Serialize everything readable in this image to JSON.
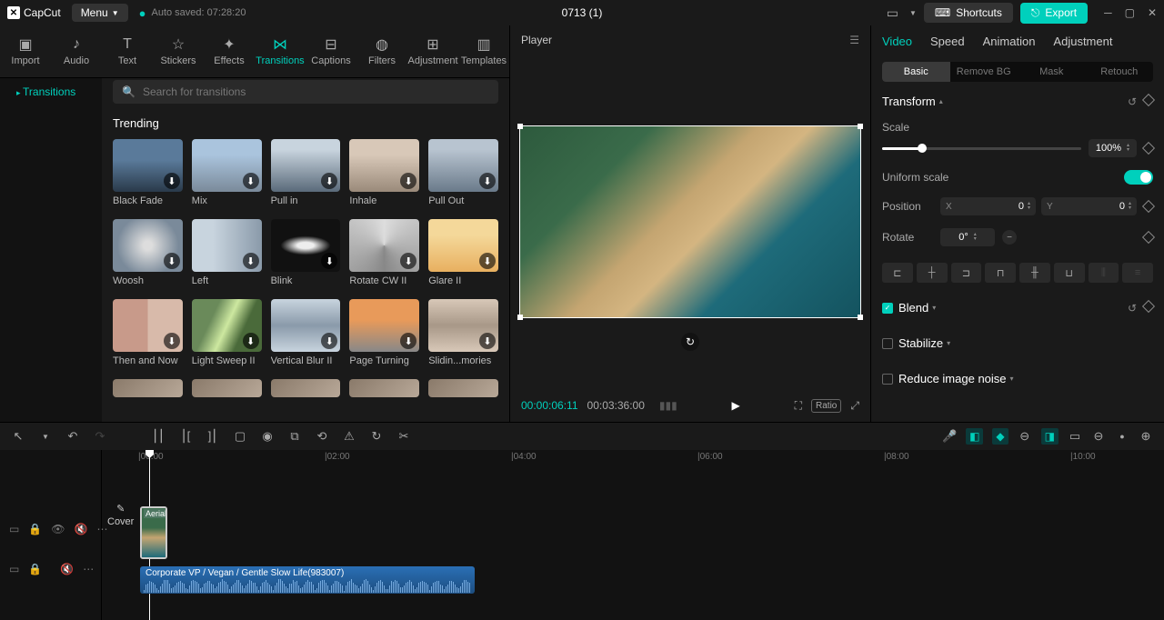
{
  "titlebar": {
    "app_name": "CapCut",
    "menu_label": "Menu",
    "autosave": "Auto saved: 07:28:20",
    "project_title": "0713 (1)",
    "shortcuts": "Shortcuts",
    "export": "Export"
  },
  "nav_tabs": [
    "Import",
    "Audio",
    "Text",
    "Stickers",
    "Effects",
    "Transitions",
    "Captions",
    "Filters",
    "Adjustment",
    "Templates"
  ],
  "nav_active": 5,
  "sidebar": {
    "item": "Transitions"
  },
  "search": {
    "placeholder": "Search for transitions"
  },
  "section": "Trending",
  "items": [
    {
      "label": "Black Fade",
      "bg": "linear-gradient(180deg,#5a7a9a 40%,#2a3a4a 100%)"
    },
    {
      "label": "Mix",
      "bg": "linear-gradient(180deg,#aac4dd 30%,#7a8a9a 100%)"
    },
    {
      "label": "Pull in",
      "bg": "linear-gradient(180deg,#c8d4de 20%,#5a6a7a 100%)"
    },
    {
      "label": "Inhale",
      "bg": "linear-gradient(180deg,#d8c8b8 30%,#9a8a7a 100%)"
    },
    {
      "label": "Pull Out",
      "bg": "linear-gradient(180deg,#b8c4d0 20%,#6a7a8a 100%)"
    },
    {
      "label": "Woosh",
      "bg": "radial-gradient(circle,#ddd 10%,#7a8a9a 70%)"
    },
    {
      "label": "Left",
      "bg": "linear-gradient(90deg,#c8d4de 30%,#8a9aaa 100%)"
    },
    {
      "label": "Blink",
      "bg": "radial-gradient(ellipse 60% 30%,#eee 20%,#111 60%)"
    },
    {
      "label": "Rotate CW II",
      "bg": "conic-gradient(#ddd,#888,#ddd)"
    },
    {
      "label": "Glare II",
      "bg": "linear-gradient(180deg,#f4d89a 30%,#e8b060 100%)"
    },
    {
      "label": "Then and Now",
      "bg": "linear-gradient(90deg,#c89a8a 50%,#d8baaa 50%)"
    },
    {
      "label": "Light Sweep II",
      "bg": "linear-gradient(115deg,#6a8a5a 30%,#cde8a0 50%,#4a6a3a 70%)"
    },
    {
      "label": "Vertical Blur II",
      "bg": "linear-gradient(180deg,#c8d4de,#8a9aaa,#c8d4de)"
    },
    {
      "label": "Page Turning",
      "bg": "linear-gradient(180deg,#e89a5a 40%,#888 100%)"
    },
    {
      "label": "Slidin...mories",
      "bg": "linear-gradient(180deg,#d8c8b8,#a89888,#d8c8b8)"
    }
  ],
  "player": {
    "title": "Player",
    "time_current": "00:00:06:11",
    "time_total": "00:03:36:00",
    "ratio": "Ratio"
  },
  "right": {
    "tabs": [
      "Video",
      "Speed",
      "Animation",
      "Adjustment"
    ],
    "active_tab": 0,
    "sub_tabs": [
      "Basic",
      "Remove BG",
      "Mask",
      "Retouch"
    ],
    "active_sub": 0,
    "transform_label": "Transform",
    "scale_label": "Scale",
    "scale_value": "100%",
    "uniform_label": "Uniform scale",
    "position_label": "Position",
    "pos_x": "0",
    "pos_y": "0",
    "rotate_label": "Rotate",
    "rotate_value": "0°",
    "blend_label": "Blend",
    "stabilize_label": "Stabilize",
    "noise_label": "Reduce image noise"
  },
  "timeline": {
    "ruler": [
      "|00:00",
      "|02:00",
      "|04:00",
      "|06:00",
      "|08:00",
      "|10:00"
    ],
    "cover_label": "Cover",
    "clip_video_label": "Aerial",
    "clip_audio_label": "Corporate VP / Vegan / Gentle Slow Life(983007)"
  }
}
